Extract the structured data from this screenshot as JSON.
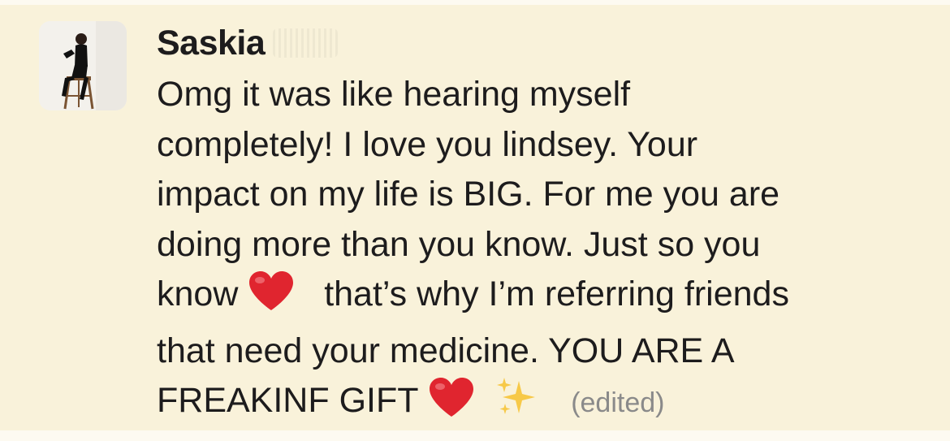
{
  "message": {
    "sender": "Saskia",
    "lines": [
      "Omg it was like hearing myself",
      "completely! I love you lindsey. Your",
      "impact on my life is BIG. For me you are",
      "doing more than you know. Just so you"
    ],
    "line5_before": "know",
    "line5_after": "that’s why I’m referring friends",
    "line6": "that need your medicine. YOU ARE A",
    "line7": "FREAKINF GIFT",
    "edited_label": "(edited)",
    "emojis": [
      "heart-emoji",
      "heart-emoji",
      "sparkles-emoji"
    ]
  },
  "colors": {
    "message_background": "#f9f2da",
    "text": "#1d1c1d",
    "edited": "#8a8a8a",
    "heart": "#e0252f",
    "sparkles": "#f7c948"
  }
}
